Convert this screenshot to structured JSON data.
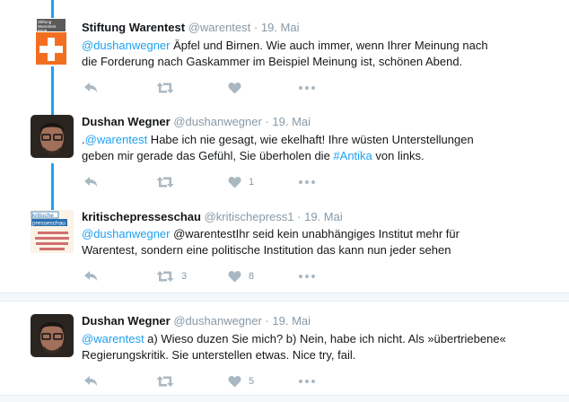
{
  "tweets": [
    {
      "name": "Stiftung Warentest",
      "handle": "@warentest",
      "sep": "·",
      "date": "19. Mai",
      "mention": "@dushanwegner",
      "text_line1": " Äpfel und Birnen. Wie auch immer, wenn Ihrer Meinung nach",
      "text_line2": "die Forderung nach Gaskammer im Beispiel Meinung ist, schönen Abend.",
      "avatar_logo_text": "Stiftung Warentest test.de",
      "retweets": "",
      "likes": ""
    },
    {
      "name": "Dushan Wegner",
      "handle": "@dushanwegner",
      "sep": "·",
      "date": "19. Mai",
      "prefix": ".",
      "mention": "@warentest",
      "text_line1": " Habe ich nie gesagt, wie ekelhaft! Ihre wüsten Unterstellungen",
      "text_line2a": "geben mir gerade das Gefühl, Sie überholen die ",
      "hashtag": "#Antika",
      "text_line2b": " von links.",
      "retweets": "",
      "likes": "1"
    },
    {
      "name": "kritischepresseschau",
      "handle": "@kritischepress1",
      "sep": "·",
      "date": "19. Mai",
      "mention": "@dushanwegner",
      "text_line1": " @warentestIhr seid kein unabhängiges Institut mehr für",
      "text_line2": "Warentest, sondern eine politische Institution das kann nun jeder sehen",
      "avatar_logo_text": "kritische presseschau",
      "retweets": "3",
      "likes": "8"
    },
    {
      "name": "Dushan Wegner",
      "handle": "@dushanwegner",
      "sep": "·",
      "date": "19. Mai",
      "mention": "@warentest",
      "text_line1": " a) Wieso duzen Sie mich? b) Nein, habe ich nicht. Als »übertriebene«",
      "text_line2": "Regierungskritik. Sie unterstellen etwas. Nice try, fail.",
      "retweets": "",
      "likes": "5"
    }
  ],
  "icons": [
    "reply-icon",
    "retweet-icon",
    "like-icon",
    "more-icon"
  ],
  "colors": {
    "link": "#1da1f2",
    "meta": "#8899a6",
    "action": "#aab8c2",
    "thread": "#1da1f2",
    "warentest_orange": "#f26f21"
  }
}
